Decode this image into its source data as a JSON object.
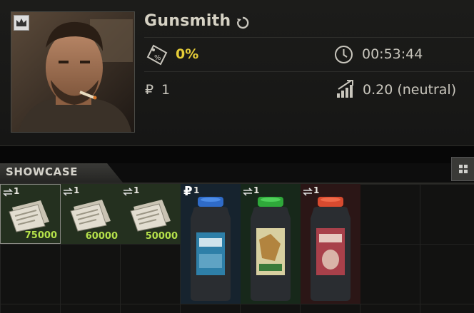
{
  "trader": {
    "name": "Gunsmith",
    "discount": "0%",
    "timer": "00:53:44",
    "currency_symbol": "₽",
    "balance": "1",
    "standing": "0.20 (neutral)"
  },
  "showcase": {
    "label": "SHOWCASE"
  },
  "items": [
    {
      "count": "1",
      "price": "75000",
      "kind": "document",
      "bg": "#24301f"
    },
    {
      "count": "1",
      "price": "60000",
      "kind": "document",
      "bg": "#24301f"
    },
    {
      "count": "1",
      "price": "50000",
      "kind": "document",
      "bg": "#24301f"
    },
    {
      "count": "1",
      "price": "",
      "kind": "jar-blue",
      "bg": "#16232e",
      "currency": "₽"
    },
    {
      "count": "1",
      "price": "",
      "kind": "jar-green",
      "bg": "#17281a"
    },
    {
      "count": "1",
      "price": "",
      "kind": "jar-red",
      "bg": "#2b1616"
    }
  ],
  "colors": {
    "accent_yellow": "#e6cd38",
    "price_green": "#b4e04a"
  }
}
